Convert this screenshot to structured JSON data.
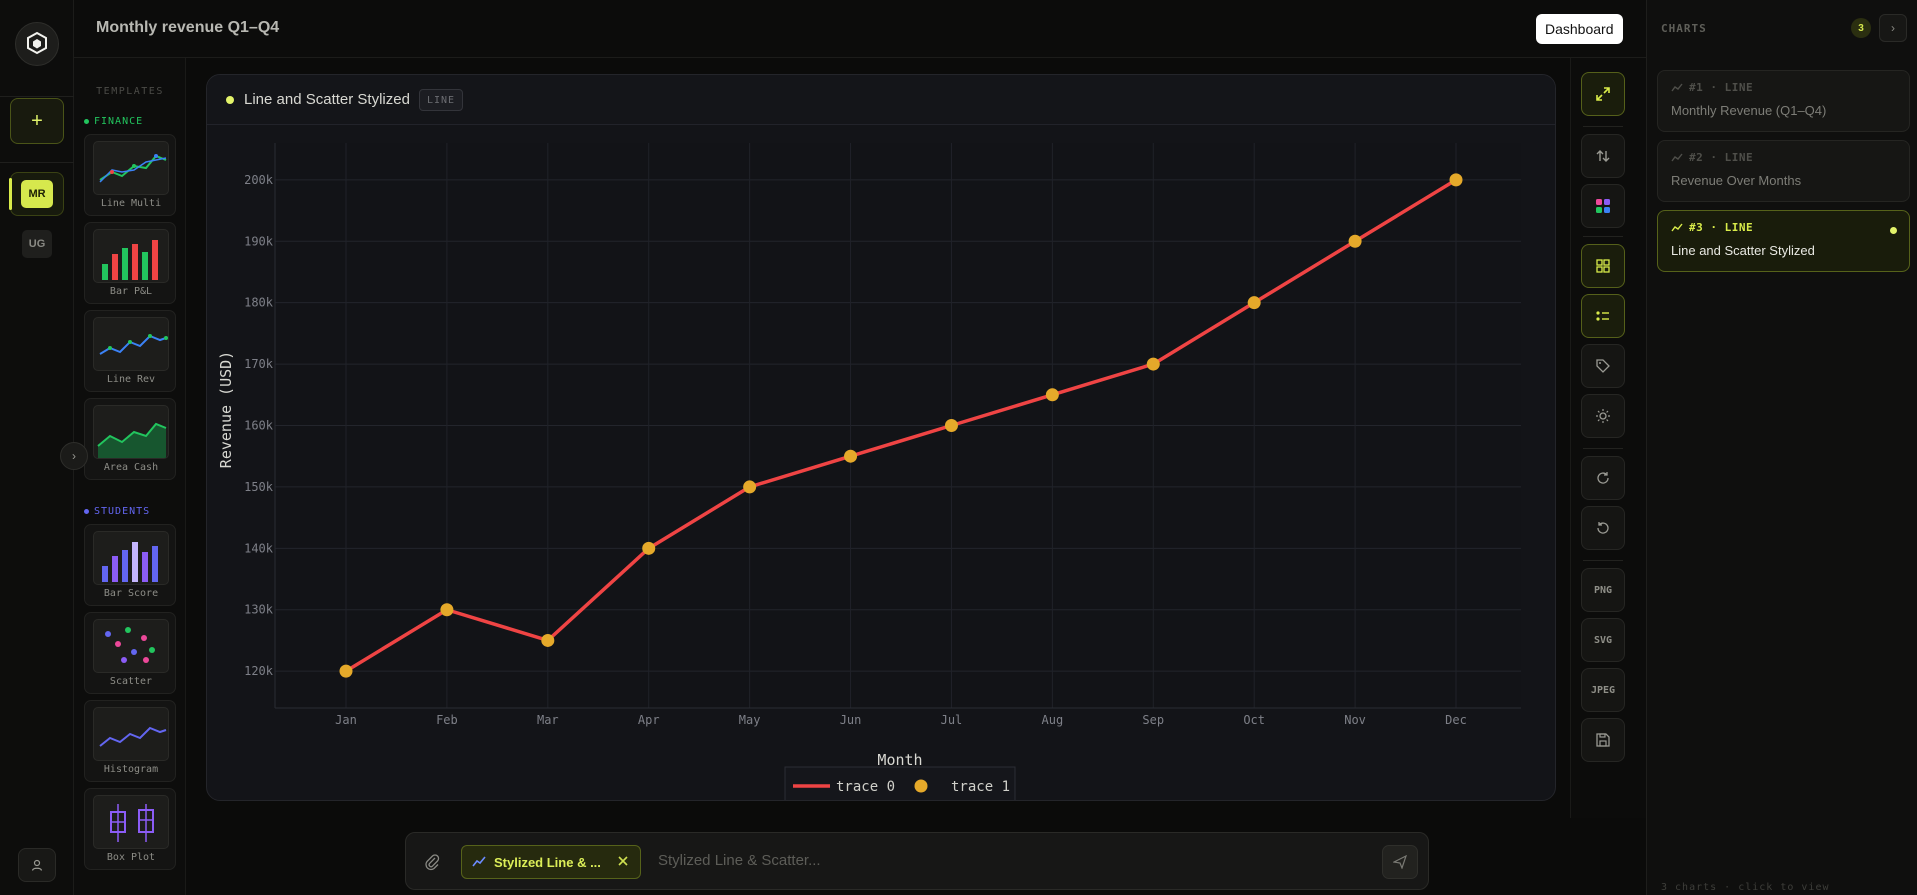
{
  "header": {
    "title": "Monthly revenue Q1–Q4",
    "dashboard_label": "Dashboard"
  },
  "rail": {
    "add_label": "+",
    "workspaces": [
      "MR",
      "UG"
    ]
  },
  "templates": {
    "heading": "TEMPLATES",
    "groups": [
      {
        "name": "FINANCE",
        "color": "#22c55e",
        "items": [
          "Line Multi",
          "Bar P&L",
          "Line Rev",
          "Area Cash"
        ]
      },
      {
        "name": "STUDENTS",
        "color": "#6366f1",
        "items": [
          "Bar Score",
          "Scatter",
          "Histogram",
          "Box Plot"
        ]
      }
    ]
  },
  "card": {
    "title": "Line and Scatter Stylized",
    "type_badge": "LINE"
  },
  "chart_data": {
    "type": "line",
    "categories": [
      "Jan",
      "Feb",
      "Mar",
      "Apr",
      "May",
      "Jun",
      "Jul",
      "Aug",
      "Sep",
      "Oct",
      "Nov",
      "Dec"
    ],
    "series": [
      {
        "name": "trace 0",
        "mode": "lines",
        "color": "#ef4444",
        "values": [
          120000,
          130000,
          125000,
          140000,
          150000,
          155000,
          160000,
          165000,
          170000,
          180000,
          190000,
          200000
        ]
      },
      {
        "name": "trace 1",
        "mode": "markers",
        "color": "#e5a92a",
        "values": [
          120000,
          130000,
          125000,
          140000,
          150000,
          155000,
          160000,
          165000,
          170000,
          180000,
          190000,
          200000
        ]
      }
    ],
    "title": "",
    "xlabel": "Month",
    "ylabel": "Revenue (USD)",
    "ylim": [
      114000,
      206000
    ],
    "yticks": [
      120000,
      130000,
      140000,
      150000,
      160000,
      170000,
      180000,
      190000,
      200000
    ],
    "ytick_labels": [
      "120k",
      "130k",
      "140k",
      "150k",
      "160k",
      "170k",
      "180k",
      "190k",
      "200k"
    ],
    "grid": true,
    "legend": "bottom-center"
  },
  "tools": {
    "png": "PNG",
    "svg": "SVG",
    "jpeg": "JPEG"
  },
  "charts_panel": {
    "heading": "CHARTS",
    "count": "3",
    "items": [
      {
        "meta": "#1 · LINE",
        "name": "Monthly Revenue (Q1–Q4)"
      },
      {
        "meta": "#2 · LINE",
        "name": "Revenue Over Months"
      },
      {
        "meta": "#3 · LINE",
        "name": "Line and Scatter Stylized"
      }
    ],
    "footer": "3 charts · click to view"
  },
  "prompt": {
    "chip_label": "Stylized Line & ...",
    "placeholder": "Stylized Line & Scatter..."
  },
  "colors": {
    "accent": "#d9ec4a",
    "line": "#ef4444",
    "marker": "#e5a92a"
  }
}
